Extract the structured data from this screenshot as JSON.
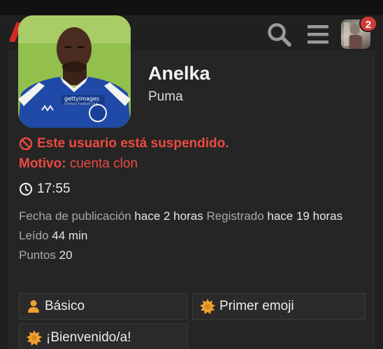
{
  "header": {
    "notification_count": "2"
  },
  "user": {
    "name": "Anelka",
    "title": "Puma",
    "photo_caption": "gettyimages",
    "photo_sub": "Chelsea Football Club"
  },
  "suspension": {
    "message": "Este usuario está suspendido.",
    "reason_label": "Motivo:",
    "reason_value": "cuenta clon"
  },
  "local_time": "17:55",
  "stats": {
    "posted_label": "Fecha de publicación",
    "posted_value": "hace 2 horas",
    "registered_label": "Registrado",
    "registered_value": "hace 19 horas",
    "read_label": "Leído",
    "read_value": "44 min",
    "points_label": "Puntos",
    "points_value": "20"
  },
  "badges": [
    {
      "label": "Básico",
      "icon": "user-icon"
    },
    {
      "label": "Primer emoji",
      "icon": "badge-burst-icon"
    },
    {
      "label": "¡Bienvenido/a!",
      "icon": "badge-burst-icon"
    }
  ],
  "colors": {
    "danger": "#ec4a41",
    "badge_icon": "#f0a030",
    "background": "#202020"
  }
}
